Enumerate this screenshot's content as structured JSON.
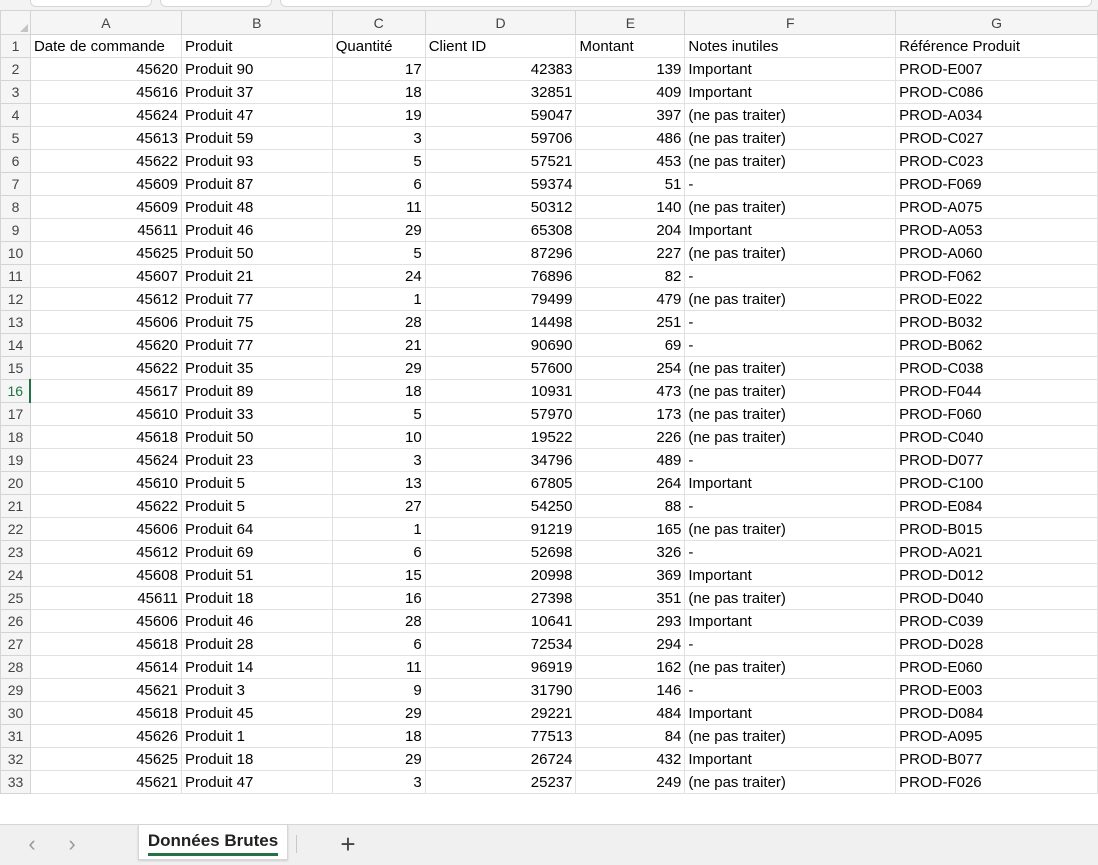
{
  "columns": [
    "A",
    "B",
    "C",
    "D",
    "E",
    "F",
    "G"
  ],
  "header_row": {
    "row_number": "1",
    "cells": [
      "Date de commande",
      "Produit",
      "Quantité",
      "Client ID",
      "Montant",
      "Notes inutiles",
      "Référence Produit"
    ]
  },
  "rows": [
    {
      "n": "2",
      "a": "45620",
      "b": "Produit 90",
      "c": "17",
      "d": "42383",
      "e": "139",
      "f": "Important",
      "g": "PROD-E007"
    },
    {
      "n": "3",
      "a": "45616",
      "b": "Produit 37",
      "c": "18",
      "d": "32851",
      "e": "409",
      "f": "Important",
      "g": "PROD-C086"
    },
    {
      "n": "4",
      "a": "45624",
      "b": "Produit 47",
      "c": "19",
      "d": "59047",
      "e": "397",
      "f": "(ne pas traiter)",
      "g": "PROD-A034"
    },
    {
      "n": "5",
      "a": "45613",
      "b": "Produit 59",
      "c": "3",
      "d": "59706",
      "e": "486",
      "f": "(ne pas traiter)",
      "g": "PROD-C027"
    },
    {
      "n": "6",
      "a": "45622",
      "b": "Produit 93",
      "c": "5",
      "d": "57521",
      "e": "453",
      "f": "(ne pas traiter)",
      "g": "PROD-C023"
    },
    {
      "n": "7",
      "a": "45609",
      "b": "Produit 87",
      "c": "6",
      "d": "59374",
      "e": "51",
      "f": "-",
      "g": "PROD-F069"
    },
    {
      "n": "8",
      "a": "45609",
      "b": "Produit 48",
      "c": "11",
      "d": "50312",
      "e": "140",
      "f": "(ne pas traiter)",
      "g": "PROD-A075"
    },
    {
      "n": "9",
      "a": "45611",
      "b": "Produit 46",
      "c": "29",
      "d": "65308",
      "e": "204",
      "f": "Important",
      "g": "PROD-A053"
    },
    {
      "n": "10",
      "a": "45625",
      "b": "Produit 50",
      "c": "5",
      "d": "87296",
      "e": "227",
      "f": "(ne pas traiter)",
      "g": "PROD-A060"
    },
    {
      "n": "11",
      "a": "45607",
      "b": "Produit 21",
      "c": "24",
      "d": "76896",
      "e": "82",
      "f": "-",
      "g": "PROD-F062"
    },
    {
      "n": "12",
      "a": "45612",
      "b": "Produit 77",
      "c": "1",
      "d": "79499",
      "e": "479",
      "f": "(ne pas traiter)",
      "g": "PROD-E022"
    },
    {
      "n": "13",
      "a": "45606",
      "b": "Produit 75",
      "c": "28",
      "d": "14498",
      "e": "251",
      "f": "-",
      "g": "PROD-B032"
    },
    {
      "n": "14",
      "a": "45620",
      "b": "Produit 77",
      "c": "21",
      "d": "90690",
      "e": "69",
      "f": "-",
      "g": "PROD-B062"
    },
    {
      "n": "15",
      "a": "45622",
      "b": "Produit 35",
      "c": "29",
      "d": "57600",
      "e": "254",
      "f": "(ne pas traiter)",
      "g": "PROD-C038"
    },
    {
      "n": "16",
      "a": "45617",
      "b": "Produit 89",
      "c": "18",
      "d": "10931",
      "e": "473",
      "f": "(ne pas traiter)",
      "g": "PROD-F044"
    },
    {
      "n": "17",
      "a": "45610",
      "b": "Produit 33",
      "c": "5",
      "d": "57970",
      "e": "173",
      "f": "(ne pas traiter)",
      "g": "PROD-F060"
    },
    {
      "n": "18",
      "a": "45618",
      "b": "Produit 50",
      "c": "10",
      "d": "19522",
      "e": "226",
      "f": "(ne pas traiter)",
      "g": "PROD-C040"
    },
    {
      "n": "19",
      "a": "45624",
      "b": "Produit 23",
      "c": "3",
      "d": "34796",
      "e": "489",
      "f": "-",
      "g": "PROD-D077"
    },
    {
      "n": "20",
      "a": "45610",
      "b": "Produit 5",
      "c": "13",
      "d": "67805",
      "e": "264",
      "f": "Important",
      "g": "PROD-C100"
    },
    {
      "n": "21",
      "a": "45622",
      "b": "Produit 5",
      "c": "27",
      "d": "54250",
      "e": "88",
      "f": "-",
      "g": "PROD-E084"
    },
    {
      "n": "22",
      "a": "45606",
      "b": "Produit 64",
      "c": "1",
      "d": "91219",
      "e": "165",
      "f": "(ne pas traiter)",
      "g": "PROD-B015"
    },
    {
      "n": "23",
      "a": "45612",
      "b": "Produit 69",
      "c": "6",
      "d": "52698",
      "e": "326",
      "f": "-",
      "g": "PROD-A021"
    },
    {
      "n": "24",
      "a": "45608",
      "b": "Produit 51",
      "c": "15",
      "d": "20998",
      "e": "369",
      "f": "Important",
      "g": "PROD-D012"
    },
    {
      "n": "25",
      "a": "45611",
      "b": "Produit 18",
      "c": "16",
      "d": "27398",
      "e": "351",
      "f": "(ne pas traiter)",
      "g": "PROD-D040"
    },
    {
      "n": "26",
      "a": "45606",
      "b": "Produit 46",
      "c": "28",
      "d": "10641",
      "e": "293",
      "f": "Important",
      "g": "PROD-C039"
    },
    {
      "n": "27",
      "a": "45618",
      "b": "Produit 28",
      "c": "6",
      "d": "72534",
      "e": "294",
      "f": "-",
      "g": "PROD-D028"
    },
    {
      "n": "28",
      "a": "45614",
      "b": "Produit 14",
      "c": "11",
      "d": "96919",
      "e": "162",
      "f": "(ne pas traiter)",
      "g": "PROD-E060"
    },
    {
      "n": "29",
      "a": "45621",
      "b": "Produit 3",
      "c": "9",
      "d": "31790",
      "e": "146",
      "f": "-",
      "g": "PROD-E003"
    },
    {
      "n": "30",
      "a": "45618",
      "b": "Produit 45",
      "c": "29",
      "d": "29221",
      "e": "484",
      "f": "Important",
      "g": "PROD-D084"
    },
    {
      "n": "31",
      "a": "45626",
      "b": "Produit 1",
      "c": "18",
      "d": "77513",
      "e": "84",
      "f": "(ne pas traiter)",
      "g": "PROD-A095"
    },
    {
      "n": "32",
      "a": "45625",
      "b": "Produit 18",
      "c": "29",
      "d": "26724",
      "e": "432",
      "f": "Important",
      "g": "PROD-B077"
    },
    {
      "n": "33",
      "a": "45621",
      "b": "Produit 47",
      "c": "3",
      "d": "25237",
      "e": "249",
      "f": "(ne pas traiter)",
      "g": "PROD-F026"
    }
  ],
  "active_row": "16",
  "sheet_tabs": [
    {
      "label": "Données Brutes",
      "active": true
    }
  ],
  "nav": {
    "prev_icon": "chevron-left-icon",
    "next_icon": "chevron-right-icon",
    "prev_glyph": "‹",
    "next_glyph": "›"
  },
  "add_sheet": {
    "icon": "plus-icon",
    "glyph": "+"
  },
  "colors": {
    "accent": "#217346",
    "header_bg": "#f5f5f5",
    "gridline": "#e1e1e1"
  }
}
